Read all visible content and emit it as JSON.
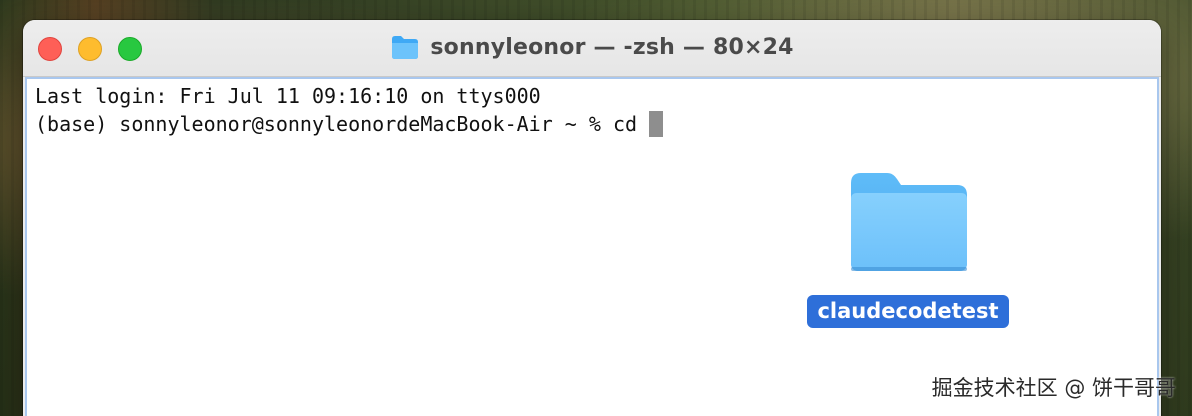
{
  "window": {
    "title": "sonnyleonor — -zsh — 80×24",
    "title_icon": "folder-icon"
  },
  "traffic_lights": {
    "close_color": "#fe5f57",
    "minimize_color": "#febc2e",
    "zoom_color": "#28c840"
  },
  "terminal": {
    "lines": [
      "Last login: Fri Jul 11 09:16:10 on ttys000",
      "(base) sonnyleonor@sonnyleonordeMacBook-Air ~ % cd"
    ],
    "cursor": "block-cursor"
  },
  "desktop": {
    "folder": {
      "label": "claudecodetest",
      "icon": "folder-icon",
      "selected": true,
      "selection_color": "#2e6fd9"
    }
  },
  "watermark": {
    "text": "掘金技术社区 @ 饼干哥哥"
  }
}
